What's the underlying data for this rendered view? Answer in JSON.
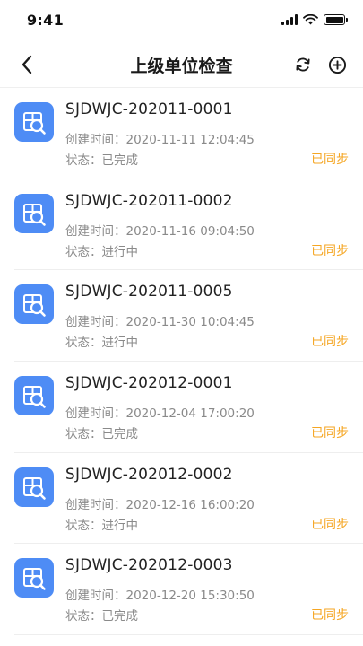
{
  "status_bar": {
    "time": "9:41",
    "icons": [
      "signal-icon",
      "wifi-icon",
      "battery-icon"
    ]
  },
  "header": {
    "title": "上级单位检查",
    "back_icon": "chevron-left-icon",
    "refresh_icon": "refresh-icon",
    "add_icon": "plus-circle-icon"
  },
  "colors": {
    "accent_blue": "#4e8cf5",
    "sync_orange": "#f5a623",
    "muted_text": "#8a8a8a"
  },
  "items": [
    {
      "code": "SJDWJC-202011-0001",
      "created": "创建时间：2020-11-11 12:04:45",
      "status": "状态：已完成",
      "sync": "已同步"
    },
    {
      "code": "SJDWJC-202011-0002",
      "created": "创建时间：2020-11-16 09:04:50",
      "status": "状态：进行中",
      "sync": "已同步"
    },
    {
      "code": "SJDWJC-202011-0005",
      "created": "创建时间：2020-11-30 10:04:45",
      "status": "状态：进行中",
      "sync": "已同步"
    },
    {
      "code": "SJDWJC-202012-0001",
      "created": "创建时间：2020-12-04 17:00:20",
      "status": "状态：已完成",
      "sync": "已同步"
    },
    {
      "code": "SJDWJC-202012-0002",
      "created": "创建时间：2020-12-16 16:00:20",
      "status": "状态：进行中",
      "sync": "已同步"
    },
    {
      "code": "SJDWJC-202012-0003",
      "created": "创建时间：2020-12-20 15:30:50",
      "status": "状态：已完成",
      "sync": "已同步"
    }
  ]
}
